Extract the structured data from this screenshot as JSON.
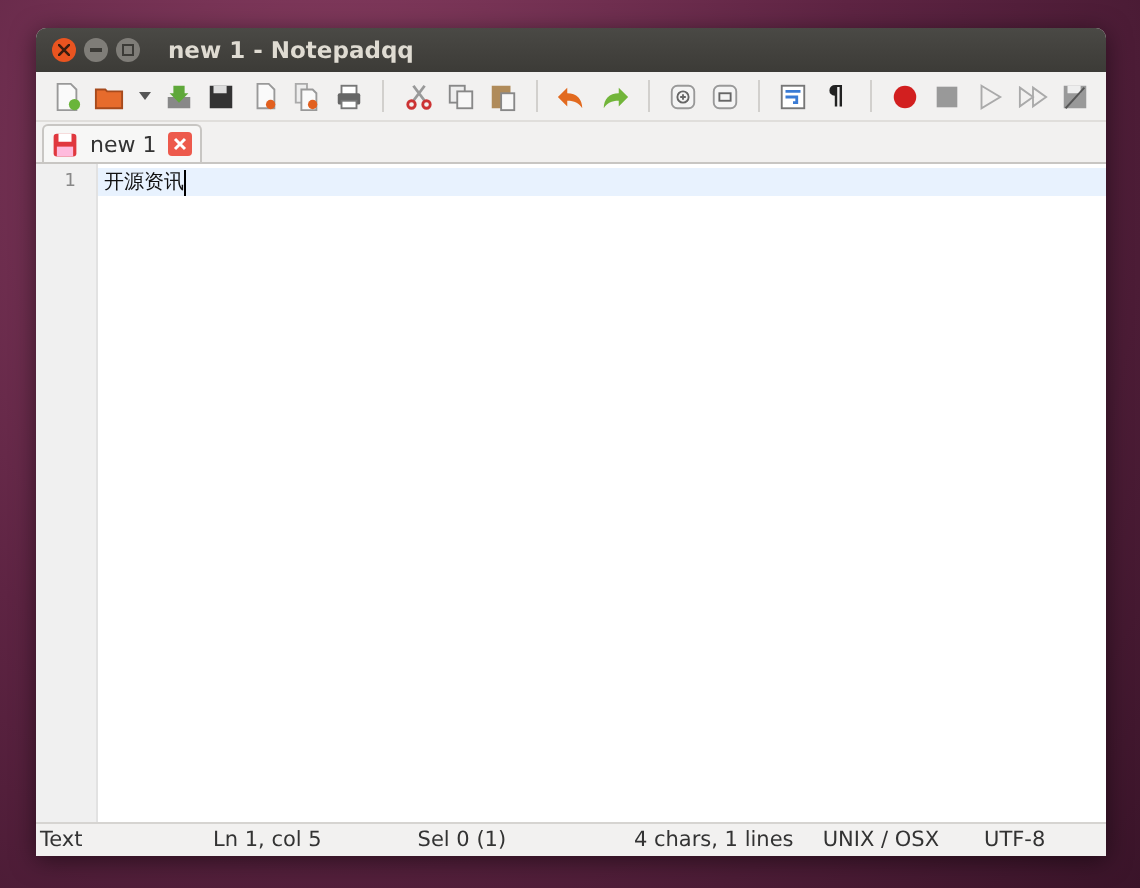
{
  "window": {
    "title": "new 1 - Notepadqq"
  },
  "toolbar": [
    [
      {
        "kind": "new"
      },
      {
        "kind": "open"
      },
      {
        "kind": "caret"
      },
      {
        "kind": "reload"
      },
      {
        "kind": "save"
      },
      {
        "kind": "close"
      },
      {
        "kind": "closeall"
      },
      {
        "kind": "print"
      }
    ],
    [
      {
        "kind": "cut"
      },
      {
        "kind": "copy"
      },
      {
        "kind": "paste"
      }
    ],
    [
      {
        "kind": "undo"
      },
      {
        "kind": "redo"
      }
    ],
    [
      {
        "kind": "zoomin"
      },
      {
        "kind": "zoomout"
      }
    ],
    [
      {
        "kind": "wrap"
      },
      {
        "kind": "glyph",
        "text": "¶"
      }
    ],
    [
      {
        "kind": "record"
      },
      {
        "kind": "stop"
      },
      {
        "kind": "play"
      },
      {
        "kind": "playmany"
      },
      {
        "kind": "savemacro"
      }
    ]
  ],
  "tabs": [
    {
      "label": "new 1",
      "selected": true
    }
  ],
  "editor": {
    "lines": [
      {
        "number": "1",
        "text": "开源资讯",
        "current": true
      }
    ]
  },
  "status_bar": [
    "Text",
    "Ln 1, col 5",
    "Sel 0 (1)",
    "4 chars, 1 lines",
    "UNIX / OSX",
    "UTF-8"
  ]
}
